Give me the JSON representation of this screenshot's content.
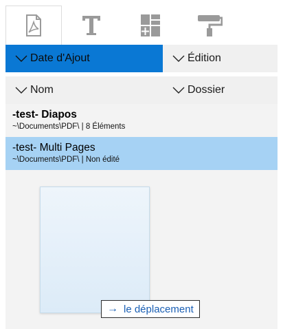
{
  "toolbar": {
    "tools": [
      {
        "icon": "pdf-file-icon",
        "active": true
      },
      {
        "icon": "text-icon",
        "active": false
      },
      {
        "icon": "grid-layout-icon",
        "active": false
      },
      {
        "icon": "paint-roller-icon",
        "active": false
      }
    ]
  },
  "sort": {
    "date_added": "Date d'Ajout",
    "edition": "Édition",
    "name": "Nom",
    "folder": "Dossier",
    "active": "date_added"
  },
  "files": [
    {
      "title": "-test- Diapos",
      "subtitle": "~\\Documents\\PDF\\ | 8 Éléments",
      "bold": true,
      "selected": false
    },
    {
      "title": "-test- Multi Pages",
      "subtitle": "~\\Documents\\PDF\\ | Non édité",
      "bold": false,
      "selected": true
    }
  ],
  "drag_tooltip": {
    "arrow": "→",
    "label": "le déplacement"
  },
  "colors": {
    "accent": "#0a78d4",
    "selection": "#a6d2f4",
    "link": "#1a5fb4"
  }
}
